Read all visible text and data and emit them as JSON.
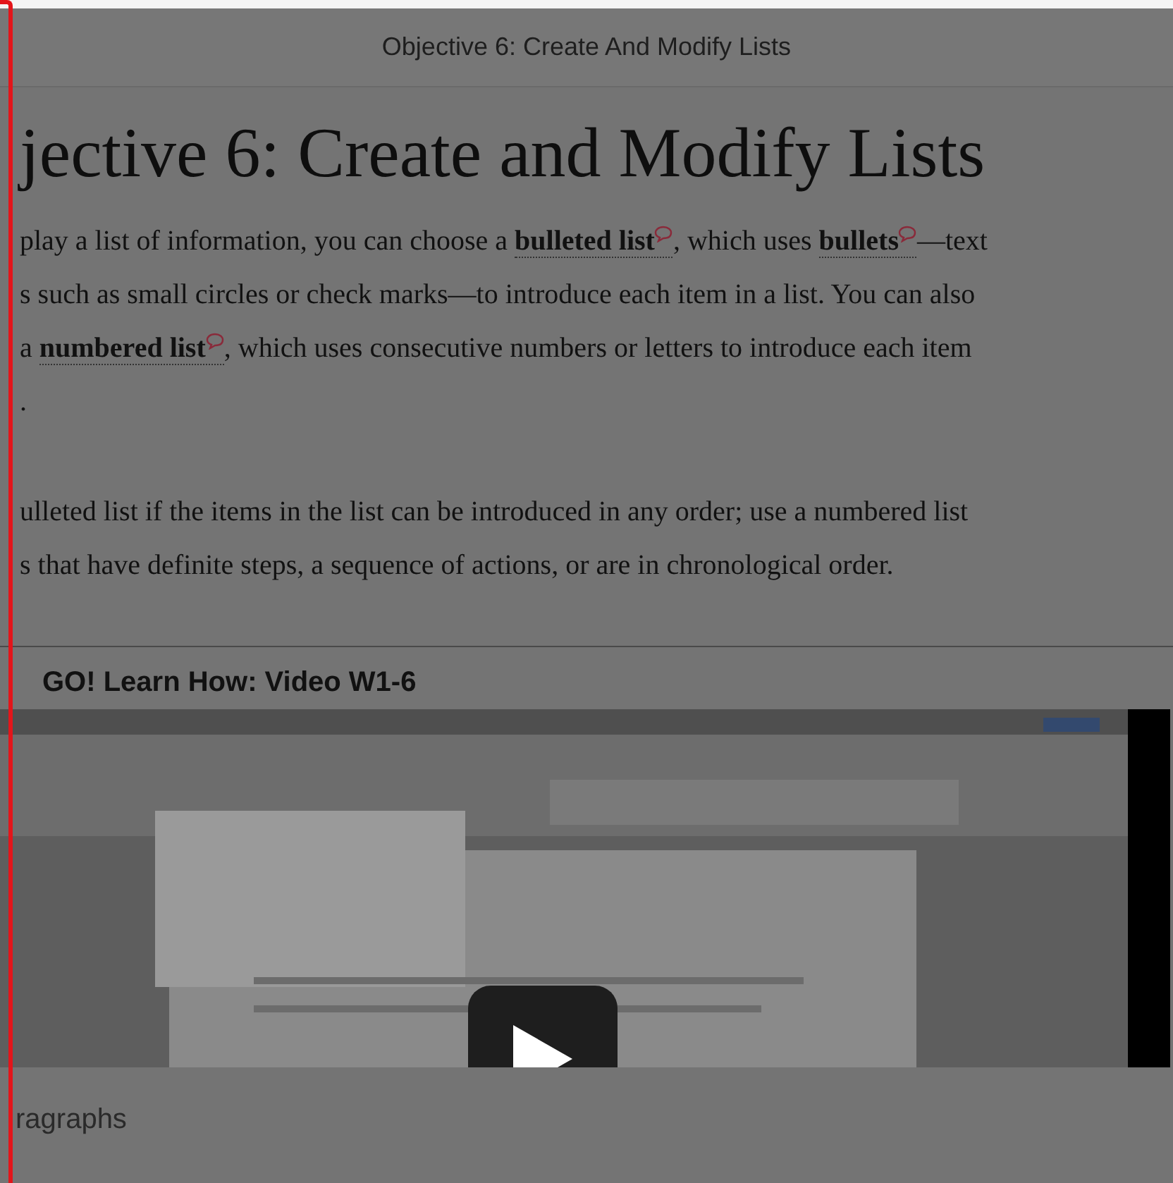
{
  "header": {
    "title": "Objective 6: Create And Modify Lists"
  },
  "heading": "jective 6: Create and Modify Lists",
  "paragraphs": [
    {
      "lines": [
        [
          {
            "kind": "plain",
            "text": "play a list of information, you can choose a "
          },
          {
            "kind": "term",
            "text": "bulleted list"
          },
          {
            "kind": "plain",
            "text": ", which uses "
          },
          {
            "kind": "term",
            "text": "bullets"
          },
          {
            "kind": "plain",
            "text": "—text"
          }
        ],
        [
          {
            "kind": "plain",
            "text": "s such as small circles or check marks—to introduce each item in a list. You can also"
          }
        ],
        [
          {
            "kind": "plain",
            "text": "a "
          },
          {
            "kind": "term",
            "text": "numbered list"
          },
          {
            "kind": "plain",
            "text": ", which uses consecutive numbers or letters to introduce each item"
          }
        ],
        [
          {
            "kind": "plain",
            "text": "."
          }
        ]
      ]
    },
    {
      "lines": [
        [
          {
            "kind": "plain",
            "text": "ulleted list if the items in the list can be introduced in any order; use a numbered list"
          }
        ],
        [
          {
            "kind": "plain",
            "text": "s that have definite steps, a sequence of actions, or are in chronological order."
          }
        ]
      ]
    }
  ],
  "video": {
    "title": "GO! Learn How: Video W1-6",
    "kind": "picture"
  },
  "next_section": "ragraphs"
}
